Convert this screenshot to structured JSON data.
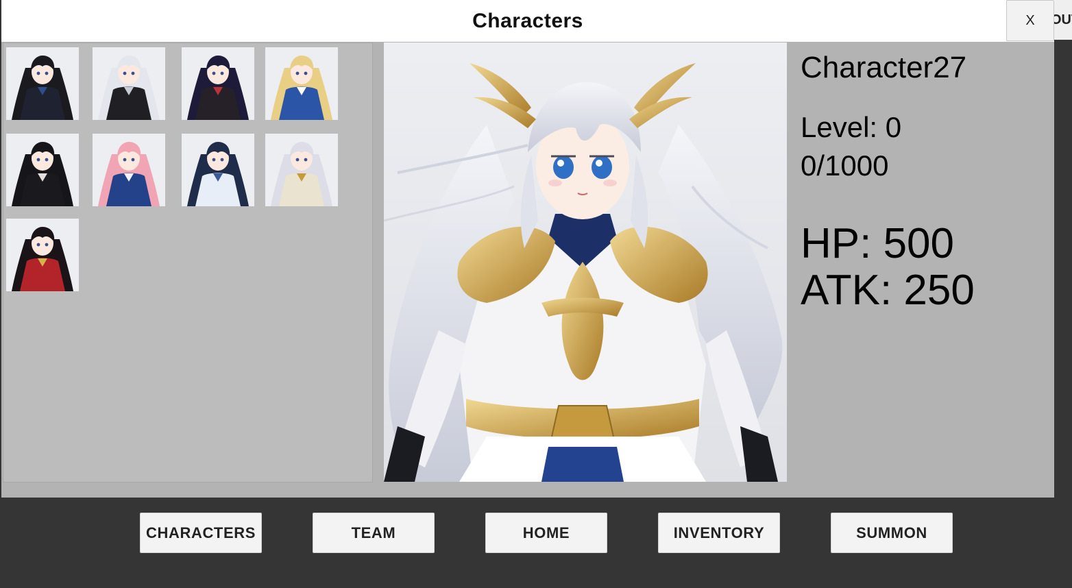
{
  "window": {
    "title": "Characters",
    "close_label": "X",
    "edge_tab_label": "OUT"
  },
  "character_list": {
    "items": [
      {
        "name": "thumb-1",
        "hair": "#1a1a1f",
        "dress": "#1f2230",
        "accent": "#2f4d8a"
      },
      {
        "name": "thumb-2",
        "hair": "#e4e6ee",
        "dress": "#202024",
        "accent": "#c9cbd6"
      },
      {
        "name": "thumb-3",
        "hair": "#1e1b3a",
        "dress": "#262029",
        "accent": "#b8333a"
      },
      {
        "name": "thumb-4",
        "hair": "#e9cf86",
        "dress": "#2b56a8",
        "accent": "#ffffff"
      },
      {
        "name": "thumb-5",
        "hair": "#16161a",
        "dress": "#1a1a1e",
        "accent": "#e5dede"
      },
      {
        "name": "thumb-6",
        "hair": "#f0a4b4",
        "dress": "#24428a",
        "accent": "#f4f4f8"
      },
      {
        "name": "thumb-7",
        "hair": "#1f2c4a",
        "dress": "#e8eef8",
        "accent": "#3a5a9a"
      },
      {
        "name": "thumb-8",
        "hair": "#dcdde6",
        "dress": "#e9e3d0",
        "accent": "#c79a36"
      },
      {
        "name": "thumb-9",
        "hair": "#1a1418",
        "dress": "#b3242a",
        "accent": "#d6b24a"
      }
    ]
  },
  "selected": {
    "name": "Character27",
    "level_text": "Level: 0",
    "exp_text": "0/1000",
    "hp_text": "HP: 500",
    "atk_text": "ATK: 250",
    "portrait_colors": {
      "hair": "#e6e8ef",
      "armor": "#f5f5f7",
      "gold": "#c9a24a",
      "navy": "#1c2f66",
      "eyes": "#2f6fc4"
    }
  },
  "nav": {
    "characters": "CHARACTERS",
    "team": "TEAM",
    "home": "HOME",
    "inventory": "INVENTORY",
    "summon": "SUMMON"
  },
  "colors": {
    "panel": "#b3b3b3",
    "list_bg": "#bcbcbc",
    "nav_bg": "#353535",
    "button": "#f3f3f3"
  }
}
